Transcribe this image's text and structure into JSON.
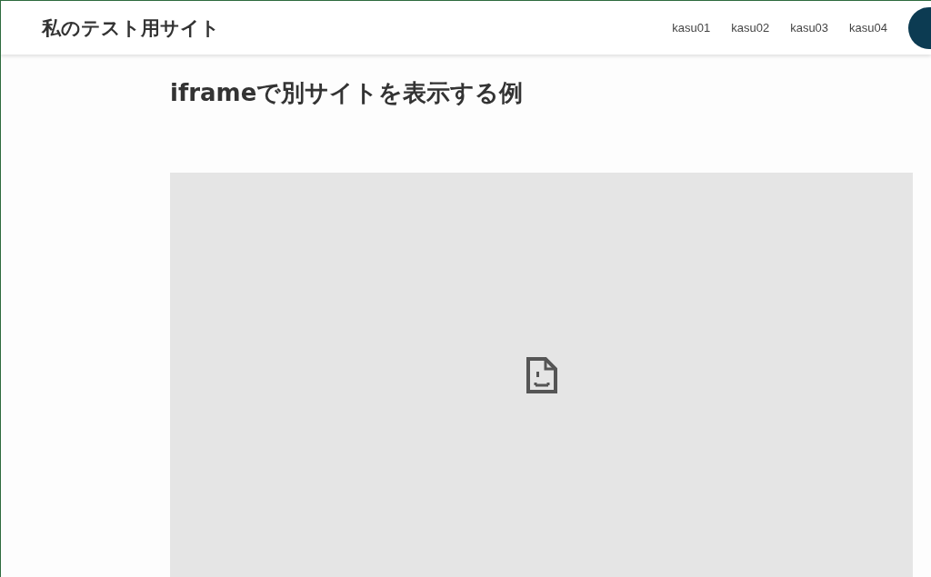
{
  "header": {
    "site_title": "私のテスト用サイト",
    "nav": [
      {
        "label": "kasu01"
      },
      {
        "label": "kasu02"
      },
      {
        "label": "kasu03"
      },
      {
        "label": "kasu04"
      }
    ]
  },
  "main": {
    "heading": "iframeで別サイトを表示する例",
    "embed": {
      "kind": "broken-page"
    }
  }
}
